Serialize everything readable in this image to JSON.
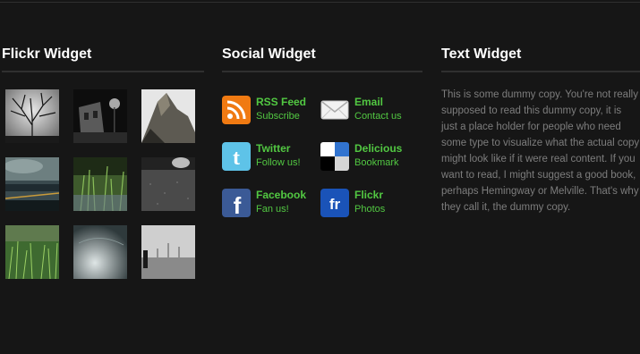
{
  "flickr": {
    "title": "Flickr Widget",
    "thumbnails": [
      {
        "name": "bare-tree-photo"
      },
      {
        "name": "foggy-street-photo"
      },
      {
        "name": "mountain-peak-photo"
      },
      {
        "name": "stormy-lake-photo"
      },
      {
        "name": "grass-closeup-photo"
      },
      {
        "name": "rainy-road-photo"
      },
      {
        "name": "meadow-photo"
      },
      {
        "name": "wet-glass-photo"
      },
      {
        "name": "misty-field-photo"
      }
    ]
  },
  "social": {
    "title": "Social Widget",
    "items": [
      {
        "label": "RSS Feed",
        "sub": "Subscribe",
        "icon": "rss-icon"
      },
      {
        "label": "Email",
        "sub": "Contact us",
        "icon": "email-icon"
      },
      {
        "label": "Twitter",
        "sub": "Follow us!",
        "icon": "twitter-icon"
      },
      {
        "label": "Delicious",
        "sub": "Bookmark",
        "icon": "delicious-icon"
      },
      {
        "label": "Facebook",
        "sub": "Fan us!",
        "icon": "facebook-icon"
      },
      {
        "label": "Flickr",
        "sub": "Photos",
        "icon": "flickr-icon"
      }
    ]
  },
  "text_widget": {
    "title": "Text Widget",
    "body": "This is some dummy copy. You're not really supposed to read this dummy copy, it is just a place holder for people who need some type to visualize what the actual copy might look like if it were real content. If you want to read, I might suggest a good book, perhaps Hemingway or Melville. That's why they call it, the dummy copy."
  },
  "colors": {
    "background": "#161616",
    "link_green": "#52c842",
    "body_text": "#7d7d7d"
  }
}
